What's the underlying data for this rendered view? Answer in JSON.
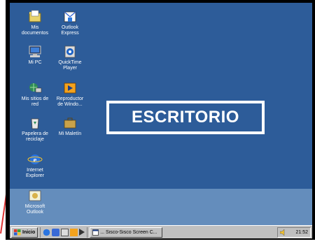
{
  "desktop": {
    "banner_text": "ESCRITORIO",
    "background_color": "#2d5c99",
    "icons": [
      {
        "name": "mis-documentos",
        "label": "Mis\ndocumentos",
        "icon": "folder-icon"
      },
      {
        "name": "outlook-express",
        "label": "Outlook\nExpress",
        "icon": "outlook-express-icon"
      },
      {
        "name": "mi-pc",
        "label": "Mi PC",
        "icon": "computer-icon"
      },
      {
        "name": "quicktime-player",
        "label": "QuickTime\nPlayer",
        "icon": "quicktime-icon"
      },
      {
        "name": "mis-sitios-de-red",
        "label": "Mis sitios de\nred",
        "icon": "network-icon"
      },
      {
        "name": "reproductor-windows",
        "label": "Reproductor\nde Windo...",
        "icon": "media-player-icon"
      },
      {
        "name": "papelera-de-reciclaje",
        "label": "Papelera de\nreciclaje",
        "icon": "recycle-bin-icon"
      },
      {
        "name": "mi-maletin",
        "label": "Mi Maletín",
        "icon": "briefcase-icon"
      },
      {
        "name": "internet-explorer",
        "label": "Internet\nExplorer",
        "icon": "internet-explorer-icon"
      },
      {
        "name": "microsoft-outlook",
        "label": "Microsoft\nOutlook",
        "icon": "outlook-icon"
      }
    ]
  },
  "taskbar": {
    "start_label": "Inicio",
    "task_label": "... Sisco-Sisco Screen C...",
    "clock": "21:52"
  }
}
